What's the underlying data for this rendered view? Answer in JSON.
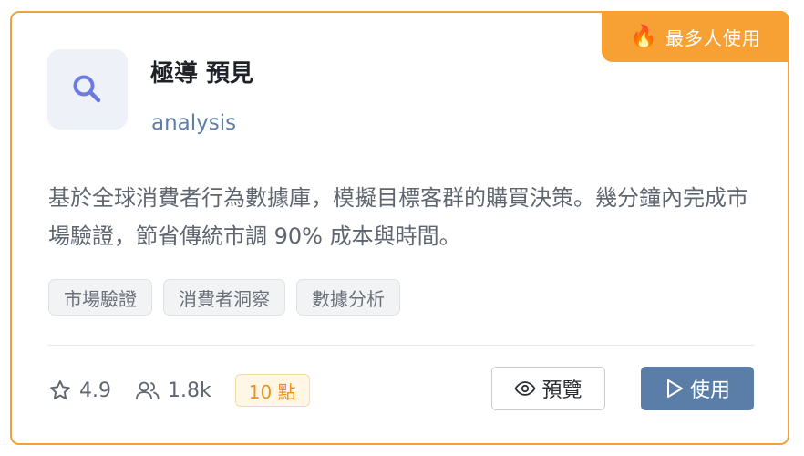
{
  "badge": {
    "label": "最多人使用",
    "icon": "fire-icon"
  },
  "tool": {
    "icon": "search-icon",
    "title": "極導 預見",
    "category": "analysis",
    "description": "基於全球消費者行為數據庫，模擬目標客群的購買決策。幾分鐘內完成市場驗證，節省傳統市調 90% 成本與時間。"
  },
  "tags": [
    "市場驗證",
    "消費者洞察",
    "數據分析"
  ],
  "stats": {
    "rating": "4.9",
    "users": "1.8k",
    "points": "10 點"
  },
  "actions": {
    "preview_label": "預覽",
    "use_label": "使用"
  },
  "colors": {
    "accent_orange": "#f7a033",
    "primary_button": "#5a7ea8",
    "icon_purple": "#6b7be0"
  }
}
